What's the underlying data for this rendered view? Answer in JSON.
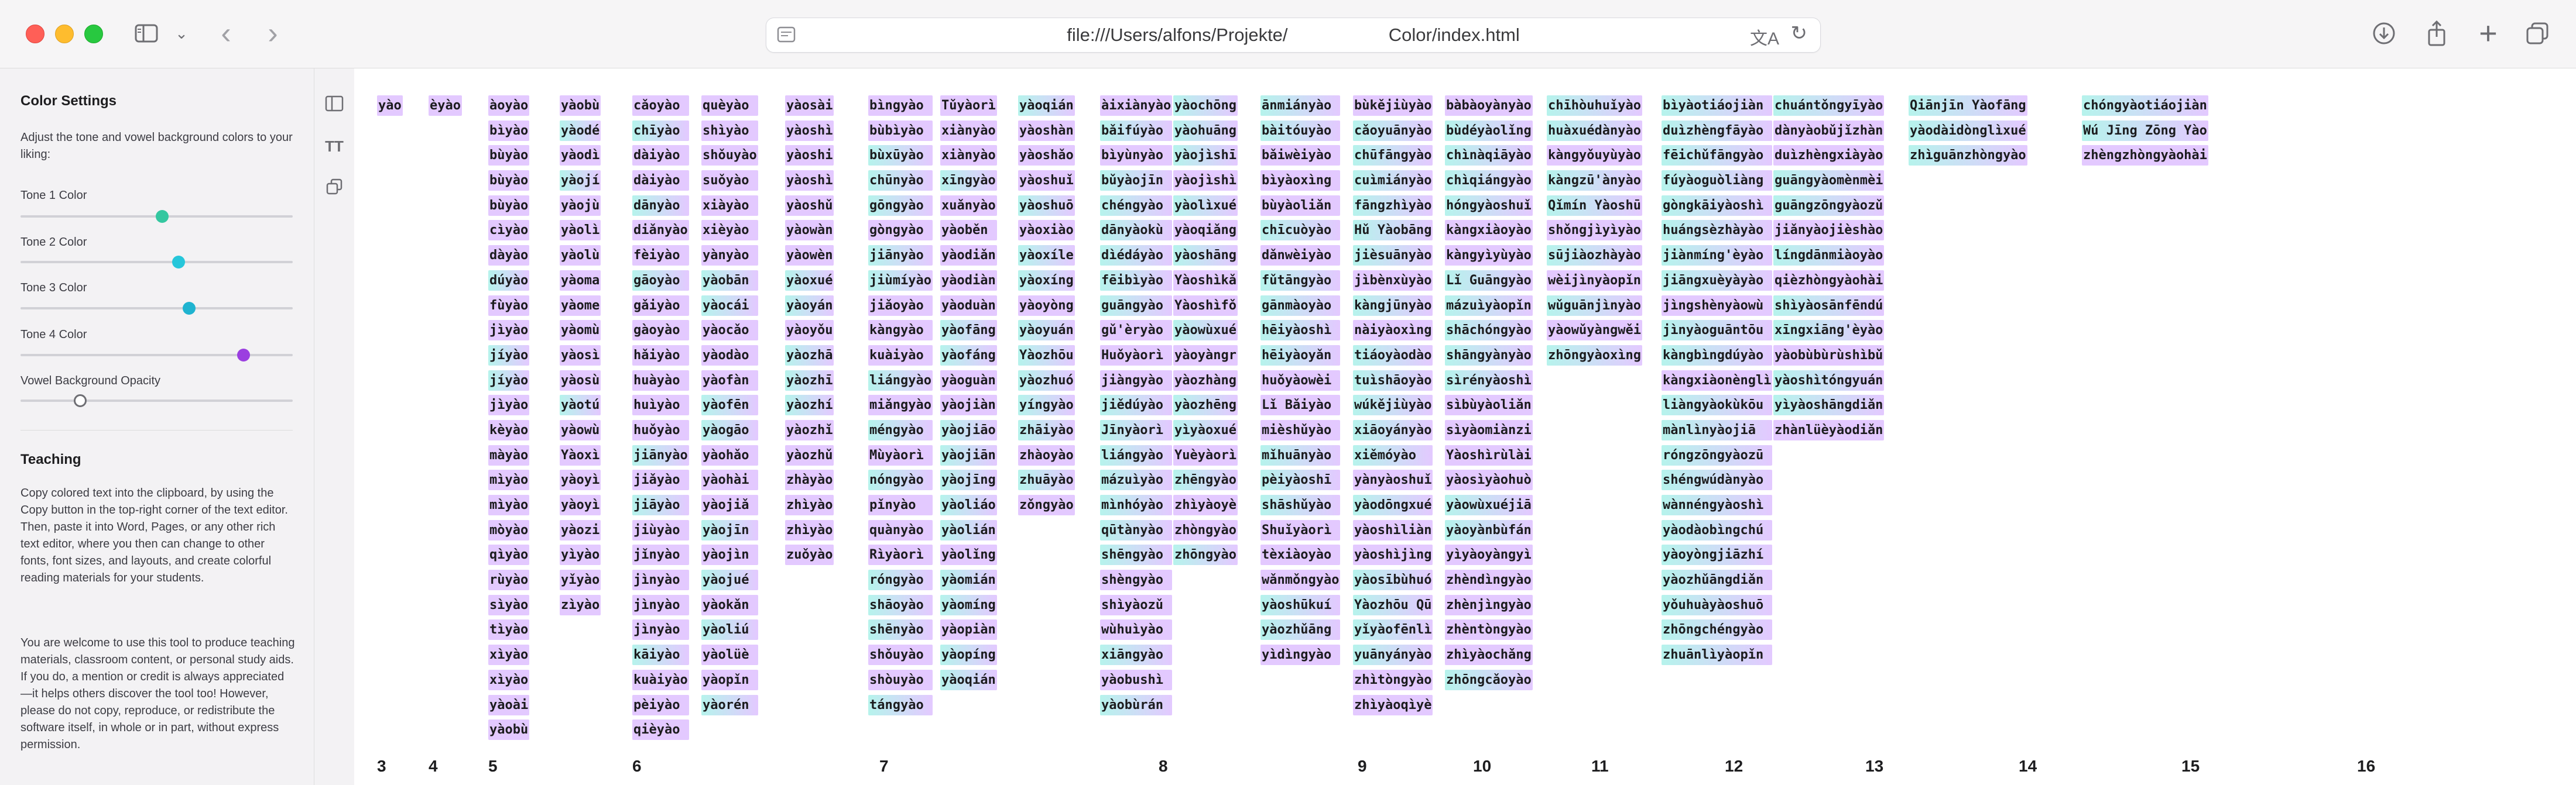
{
  "browser": {
    "url": "file:///Users/alfons/Projekte/                    Color/index.html"
  },
  "sidebar": {
    "settings_title": "Color Settings",
    "settings_desc": "Adjust the tone and vowel background colors to your liking:",
    "sliders": [
      {
        "label": "Tone 1 Color",
        "value": 0.52,
        "color": "#34c7a0"
      },
      {
        "label": "Tone 2 Color",
        "value": 0.58,
        "color": "#26c6da"
      },
      {
        "label": "Tone 3 Color",
        "value": 0.62,
        "color": "#1fb3d0"
      },
      {
        "label": "Tone 4 Color",
        "value": 0.82,
        "color": "#9b3fe0"
      },
      {
        "label": "Vowel Background Opacity",
        "value": 0.22,
        "color": "#8e8e93"
      }
    ],
    "teaching_title": "Teaching",
    "teaching_p1": "Copy colored text into the clipboard, by using the Copy button in the top-right corner of the text editor. Then, paste it into Word, Pages, or any other rich text editor, where you then can change to other fonts, font sizes, and layouts, and create colorful reading materials for your students.",
    "teaching_p2": "You are welcome to use this tool to produce teaching materials, classroom content, or personal study aids. If you do, a mention or credit is always appreciated—it helps others discover the tool too! However, please do not copy, reproduce, or redistribute the software itself, in whole or in part, without express permission."
  },
  "colors": {
    "hi_purple": "#e3c9ff",
    "hi_cyan": "#b6f3ec"
  },
  "columns": [
    {
      "x": 0,
      "words": [
        "yào"
      ]
    },
    {
      "x": 0,
      "words": [
        "èyào"
      ]
    },
    {
      "x": 0,
      "words": [
        "àoyào",
        "bìyào",
        "bùyào",
        "bùyào",
        "bùyào",
        "cìyào",
        "dàyào",
        "dúyào",
        "fùyào",
        "jìyào",
        "jíyào",
        "jíyào",
        "jìyào",
        "kèyào",
        "màyào",
        "mìyào",
        "mìyào",
        "mòyào",
        "qìyào",
        "rùyào",
        "sìyào",
        "tìyào",
        "xìyào",
        "xìyào",
        "yàoài",
        "yàobù"
      ]
    },
    {
      "x": 0,
      "words": [
        "yàobù",
        "yàodé",
        "yàodì",
        "yàojí",
        "yàojù",
        "yàolì",
        "yàolù",
        "yàoma",
        "yàome",
        "yàomù",
        "yàosì",
        "yàosù",
        "yàotú",
        "yàowù",
        "Yàoxì",
        "yàoyì",
        "yàoyì",
        "yàozi",
        "yìyào",
        "yǐyào",
        "zìyào"
      ]
    },
    {
      "x": 0,
      "words": [
        "cǎoyào",
        "chīyào",
        "dàiyào",
        "dàiyào",
        "dānyào",
        "diǎnyào",
        "fèiyào",
        "gāoyào",
        "gǎiyào",
        "gàoyào",
        "hǎiyào",
        "huàyào",
        "huìyào",
        "huǒyào",
        "jiānyào",
        "jiǎyào",
        "jiāyào",
        "jiùyào",
        "jǐnyào",
        "jìnyào",
        "jìnyào",
        "jìnyào",
        "kāiyào",
        "kuàiyào",
        "pèiyào",
        "qièyào"
      ]
    },
    {
      "x": 0,
      "words": [
        "quèyào",
        "shìyào",
        "shǒuyào",
        "suǒyào",
        "xiàyào",
        "xièyào",
        "yànyào",
        "yàobān",
        "yàocái",
        "yàocǎo",
        "yàodào",
        "yàofàn",
        "yàofēn",
        "yàogāo",
        "yàohǎo",
        "yàohài",
        "yàojiǎ",
        "yàojīn",
        "yàojìn",
        "yàojué",
        "yàokǎn",
        "yàoliú",
        "yàolüè",
        "yàopǐn",
        "yàorén"
      ]
    },
    {
      "x": 0,
      "words": [
        "yàosài",
        "yàoshì",
        "yàoshi",
        "yàoshì",
        "yàoshǔ",
        "yàowàn",
        "yàowèn",
        "yàoxué",
        "yàoyán",
        "yàoyǒu",
        "yàozhā",
        "yàozhī",
        "yàozhí",
        "yàozhǐ",
        "yàozhǔ",
        "zhàyào",
        "zhìyào",
        "zhìyào",
        "zuǒyào"
      ]
    },
    {
      "x": 0,
      "words": [
        "bìngyào",
        "bùbìyào",
        "bùxūyào",
        "chūnyào",
        "gōngyào",
        "gòngyào",
        "jiānyào",
        "jiùmíyào",
        "jiǎoyào",
        "kàngyào",
        "kuàiyào",
        "liángyào",
        "miǎngyào",
        "méngyào",
        "Mùyàorì",
        "nóngyào",
        "pǐnyào",
        "quànyào",
        "Rìyàorì",
        "róngyào",
        "shāoyào",
        "shēnyào",
        "shǒuyào",
        "shòuyào",
        "tángyào"
      ]
    },
    {
      "x": 0,
      "words": [
        "Tǔyàorì",
        "xiànyào",
        "xiànyào",
        "xīngyào",
        "xuǎnyào",
        "yàoběn",
        "yàodiǎn",
        "yàodiàn",
        "yàoduàn",
        "yàofāng",
        "yàofáng",
        "yàoguàn",
        "yàojiàn",
        "yàojiāo",
        "yàojiān",
        "yàojīng",
        "yàoliáo",
        "yàolián",
        "yàolǐng",
        "yàomián",
        "yàomíng",
        "yàopiàn",
        "yàopíng",
        "yàoqián"
      ]
    },
    {
      "x": 0,
      "words": [
        "yàoqián",
        "yàoshàn",
        "yàoshǎo",
        "yàoshuǐ",
        "yàoshuō",
        "yàoxiào",
        "yàoxíle",
        "yàoxíng",
        "yàoyòng",
        "yàoyuán",
        "Yàozhōu",
        "yàozhuó",
        "yíngyào",
        "zhāiyào",
        "zhàoyào",
        "zhuāyào",
        "zǒngyào"
      ]
    },
    {
      "x": 0,
      "words": [
        "àixiànyào",
        "bǎifúyào",
        "bìyùnyào",
        "bǔyàojīn",
        "chéngyào",
        "dānyàokù",
        "dìédáyào",
        "fēibìyào",
        "guāngyào",
        "gǔ'èryào",
        "Huǒyàorì",
        "jiàngyào",
        "jiědúyào",
        "Jīnyàorì",
        "liángyào",
        "mázuìyào",
        "mìnhóyào",
        "qūtànyào",
        "shēngyào",
        "shèngyào",
        "shìyàozǔ",
        "wùhuìyào",
        "xiāngyào",
        "yàobushì",
        "yàobùrán"
      ]
    },
    {
      "x": 0,
      "words": [
        "yàochōng",
        "yàohuāng",
        "yàojìshī",
        "yàojìshì",
        "yàolìxué",
        "yàoqiǎng",
        "yàoshāng",
        "Yàoshìkǎ",
        "Yàoshìfǒ",
        "yàowùxué",
        "yàoyàngr",
        "yàozhàng",
        "yàozhēng",
        "yìyàoxué",
        "Yuèyàorì",
        "zhēngyào",
        "zhìyàoyè",
        "zhòngyào",
        "zhōngyào"
      ]
    },
    {
      "x": 0,
      "words": [
        "ānmiányào",
        "bàitóuyào",
        "bǎiwèiyào",
        "bìyàoxìng",
        "bùyàoliǎn",
        "chīcuòyào",
        "dǎnwèiyào",
        "fǔtāngyào",
        "gānmàoyào",
        "hēiyàoshì",
        "hēiyàoyǎn",
        "huǒyàowèi",
        "Lǐ Bǎiyào",
        "mièshǔyào",
        "mǐhuānyào",
        "pèiyàoshī",
        "shāshǔyào",
        "Shuǐyàorì",
        "tèxiàoyào",
        "wǎnmǒngyào",
        "yàoshūkuí",
        "yàozhǔāng",
        "yìdìngyào"
      ]
    },
    {
      "x": 0,
      "words": [
        "bùkějiùyào",
        "cǎoyuānyào",
        "chūfāngyào",
        "cuìmiányào",
        "fāngzhìyào",
        "Hǔ Yàobāng",
        "jièsuānyào",
        "jìbènxùyào",
        "kàngjūnyào",
        "nàiyàoxìng",
        "tiáoyàodào",
        "tuìshāoyào",
        "wúkějiùyào",
        "xiāoyányào",
        "xiěmóyào",
        "yànyàoshuǐ",
        "yàodōngxué",
        "yàoshìliàn",
        "yàoshìjìng",
        "yàosībùhuó",
        "Yàozhōu Qū",
        "yǐyàofēnlì",
        "yuānyányào",
        "zhìtòngyào",
        "zhìyàoqìyè"
      ]
    },
    {
      "x": 0,
      "words": [
        "bàbàoyànyào",
        "bùdéyàolǐng",
        "chìnàqiāyào",
        "chìqiángyào",
        "hóngyàoshuǐ",
        "kàngxiàoyào",
        "kàngyìyùyào",
        "Lǐ Guāngyào",
        "mázuìyàopǐn",
        "shāchóngyào",
        "shāngyànyào",
        "sìrényàoshì",
        "sìbùyàoliǎn",
        "sìyàomiànzi",
        "Yàoshìrùlài",
        "yàosìyàohuò",
        "yàowùxuéjiā",
        "yàoyànbùfán",
        "yìyàoyàngyì",
        "zhèndìngyào",
        "zhènjìngyào",
        "zhèntòngyào",
        "zhìyàochǎng",
        "zhōngcǎoyào"
      ]
    },
    {
      "x": 0,
      "words": [
        "chīhòuhuǐyào",
        "huàxuédànyào",
        "kàngyǒuyùyào",
        "kàngzū'ànyào",
        "Qǐmín Yàoshū",
        "shǒngjìyìyào",
        "sūjiàozhàyào",
        "wèijìnyàopǐn",
        "wǔguānjìnyào",
        "yàowǔyàngwěi",
        "zhōngyàoxìng"
      ]
    },
    {
      "x": 0,
      "words": [
        "bìyàotiáojiàn",
        "duìzhèngfāyào",
        "fēichǔfāngyào",
        "fúyàoguòliàng",
        "gòngkāiyàoshì",
        "huángsèzhàyào",
        "jiànmíng'èyào",
        "jiāngxuèyàyào",
        "jìngshènyàowù",
        "jìnyàoguāntōu",
        "kàngbìngdúyào",
        "kàngxiàonènglì",
        "liàngyàokùkōu",
        "mànlìnyàojiā",
        "róngzōngyàozū",
        "shéngwúdànyào",
        "wànnéngyàoshì",
        "yàodàobìngchú",
        "yàoyòngjiāzhí",
        "yàozhǔāngdiǎn",
        "yǒuhuàyàoshuō",
        "zhōngchéngyào",
        "zhuānlìyàopǐn"
      ]
    },
    {
      "x": 0,
      "words": [
        "chuántǒngyīyào",
        "dànyàobǔjǐzhàn",
        "duìzhèngxiàyào",
        "guāngyàomènmèi",
        "guāngzōngyàozǔ",
        "jiǎnyàojièshào",
        "língdānmiàoyào",
        "qièzhòngyàohài",
        "shìyàosānfēndú",
        "xīngxiāng'èyào",
        "yàobùbùrùshìbǔ",
        "yàoshìtóngyuán",
        "yìyàoshāngdiǎn",
        "zhànlüèyàodiǎn"
      ]
    },
    {
      "x": 0,
      "words": [
        "Qiānjīn Yàofāng",
        "yàodàidònglìxué",
        "zhìguānzhòngyào"
      ]
    },
    {
      "x": 0,
      "words": [
        "chóngyàotiáojiàn",
        "Wú Jīng Zōng Yào",
        "zhèngzhòngyàohài"
      ]
    }
  ],
  "column_numbers": [
    "3",
    "4",
    "5",
    "6",
    "7",
    "8",
    "9",
    "10",
    "11",
    "12",
    "13",
    "14",
    "15",
    "16"
  ]
}
